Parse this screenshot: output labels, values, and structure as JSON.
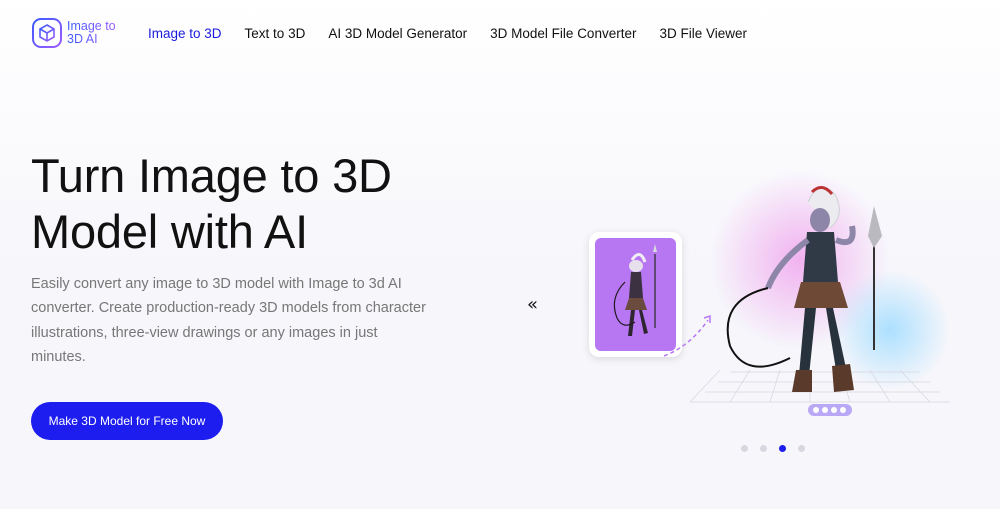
{
  "brand": {
    "logo_text": "Image to 3D AI"
  },
  "nav": {
    "items": [
      {
        "label": "Image to 3D",
        "active": true
      },
      {
        "label": "Text to 3D",
        "active": false
      },
      {
        "label": "AI 3D Model Generator",
        "active": false
      },
      {
        "label": "3D Model File Converter",
        "active": false
      },
      {
        "label": "3D File Viewer",
        "active": false
      }
    ]
  },
  "hero": {
    "title": "Turn Image to 3D Model with AI",
    "description": "Easily convert any image to 3D model with Image to 3d AI converter. Create production-ready 3D models from character illustrations, three-view drawings or any images in just minutes.",
    "cta_label": "Make 3D Model for Free Now"
  },
  "carousel": {
    "prev_glyph": "«",
    "slide_count": 4,
    "active_index": 2
  },
  "colors": {
    "accent": "#1d1df0",
    "active_nav": "#1a1adf",
    "thumbnail_bg": "#b877f2",
    "body_text": "#777777"
  }
}
